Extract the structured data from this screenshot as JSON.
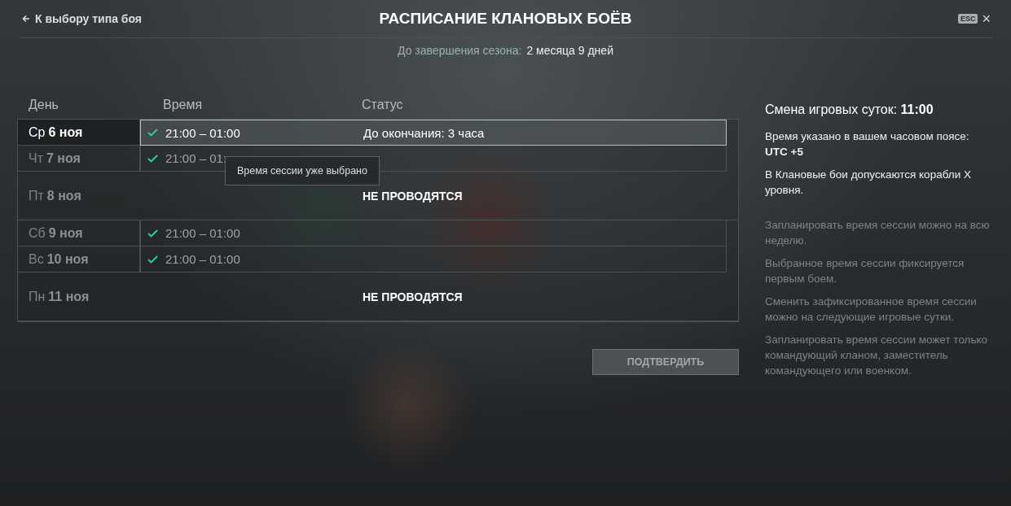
{
  "header": {
    "back_link": "К выбору типа боя",
    "title": "РАСПИСАНИЕ КЛАНОВЫХ БОЁВ",
    "esc_key": "ESC",
    "close": "×"
  },
  "season": {
    "label": "До завершения сезона:",
    "value": "2 месяца 9 дней"
  },
  "table": {
    "columns": [
      "День",
      "Время",
      "Статус"
    ],
    "rows": [
      {
        "kind": "slot",
        "weekday": "Ср",
        "date": "6 ноя",
        "selected": true,
        "checked": true,
        "time": "21:00 – 01:00",
        "status": "До окончания: 3 часа"
      },
      {
        "kind": "slot",
        "weekday": "Чт",
        "date": "7 ноя",
        "selected": false,
        "checked": true,
        "time": "21:00 – 01:"
      },
      {
        "kind": "none",
        "weekday": "Пт",
        "date": "8 ноя",
        "selected": false,
        "status": "НЕ ПРОВОДЯТСЯ"
      },
      {
        "kind": "slot",
        "weekday": "Сб",
        "date": "9 ноя",
        "selected": false,
        "checked": true,
        "time": "21:00 – 01:00"
      },
      {
        "kind": "slot",
        "weekday": "Вс",
        "date": "10 ноя",
        "selected": false,
        "checked": true,
        "time": "21:00 – 01:00"
      },
      {
        "kind": "none",
        "weekday": "Пн",
        "date": "11 ноя",
        "selected": false,
        "status": "НЕ ПРОВОДЯТСЯ"
      }
    ],
    "tooltip": "Время сессии уже выбрано"
  },
  "confirm_button": {
    "label": "ПОДТВЕРДИТЬ",
    "disabled": true
  },
  "info": {
    "day_change_label": "Смена игровых суток:",
    "day_change_value": "11:00",
    "timezone_label": "Время указано в вашем часовом поясе:",
    "timezone_value": "UTC +5",
    "ships": "В Клановые бои допускаются корабли Х уровня.",
    "notes": [
      "Запланировать время сессии можно на всю неделю.",
      "Выбранное время сессии фиксируется первым боем.",
      "Сменить зафиксированное время сессии можно на следующие игровые сутки.",
      "Запланировать время сессии может только командующий кланом, заместитель командующего или военком."
    ]
  }
}
